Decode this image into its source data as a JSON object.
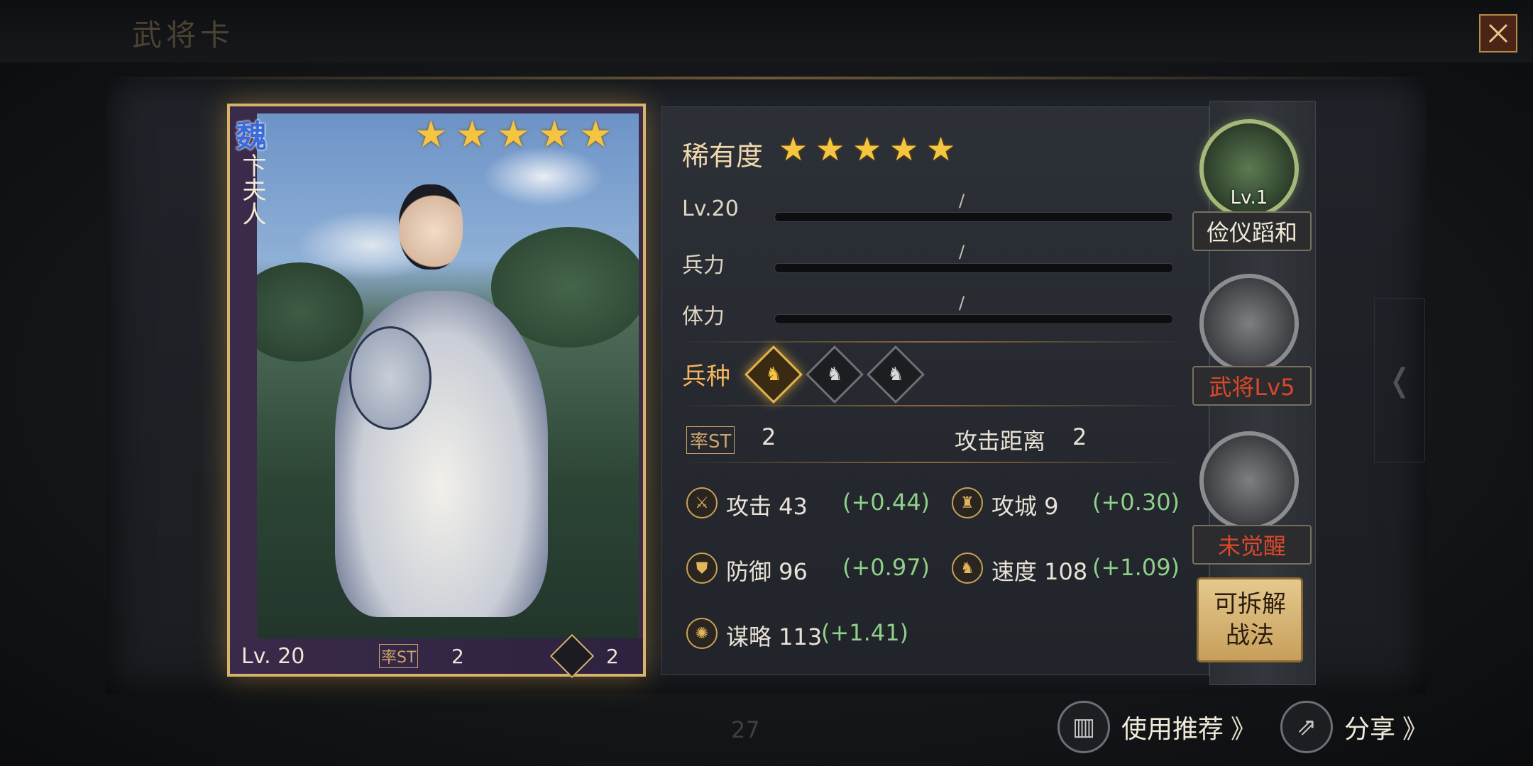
{
  "header": {
    "title": "武将卡"
  },
  "card": {
    "kingdom": "魏",
    "name": "卞夫人",
    "stars": 5,
    "level_text": "Lv. 20",
    "cost_icon": "率ST",
    "cost": "2",
    "troop_icon": "horse-icon",
    "troop_value": "2"
  },
  "stats": {
    "rarity_label": "稀有度",
    "rarity_stars": 5,
    "level_label": "Lv.20",
    "troops_label": "兵力",
    "stamina_label": "体力",
    "slash": "/",
    "troop_type_label": "兵种",
    "cost_icon": "率ST",
    "cost_value": "2",
    "range_label": "攻击距离",
    "range_value": "2",
    "attack_label": "攻击 43",
    "attack_bonus": "(+0.44)",
    "siege_label": "攻城 9",
    "siege_bonus": "(+0.30)",
    "defense_label": "防御 96",
    "defense_bonus": "(+0.97)",
    "speed_label": "速度 108",
    "speed_bonus": "(+1.09)",
    "strategy_label": "谋略 113",
    "strategy_bonus": "(+1.41)"
  },
  "side": {
    "skill1_level": "Lv.1",
    "skill1_name": "俭仪蹈和",
    "skill2_name": "武将Lv5",
    "skill3_name": "未觉醒",
    "dismantle_line1": "可拆解",
    "dismantle_line2": "战法"
  },
  "footer": {
    "page": "27",
    "recommend_label": "使用推荐",
    "share_label": "分享",
    "chevron": "》"
  },
  "colors": {
    "accent_gold": "#d8b36a",
    "bonus_green": "#8fd08a",
    "locked_red": "#d9482b"
  }
}
